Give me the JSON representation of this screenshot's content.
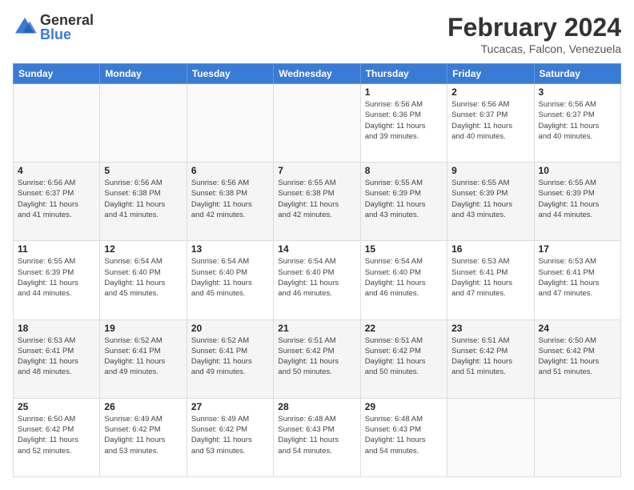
{
  "logo": {
    "general": "General",
    "blue": "Blue"
  },
  "title": "February 2024",
  "subtitle": "Tucacas, Falcon, Venezuela",
  "headers": [
    "Sunday",
    "Monday",
    "Tuesday",
    "Wednesday",
    "Thursday",
    "Friday",
    "Saturday"
  ],
  "weeks": [
    [
      {
        "day": "",
        "info": ""
      },
      {
        "day": "",
        "info": ""
      },
      {
        "day": "",
        "info": ""
      },
      {
        "day": "",
        "info": ""
      },
      {
        "day": "1",
        "info": "Sunrise: 6:56 AM\nSunset: 6:36 PM\nDaylight: 11 hours\nand 39 minutes."
      },
      {
        "day": "2",
        "info": "Sunrise: 6:56 AM\nSunset: 6:37 PM\nDaylight: 11 hours\nand 40 minutes."
      },
      {
        "day": "3",
        "info": "Sunrise: 6:56 AM\nSunset: 6:37 PM\nDaylight: 11 hours\nand 40 minutes."
      }
    ],
    [
      {
        "day": "4",
        "info": "Sunrise: 6:56 AM\nSunset: 6:37 PM\nDaylight: 11 hours\nand 41 minutes."
      },
      {
        "day": "5",
        "info": "Sunrise: 6:56 AM\nSunset: 6:38 PM\nDaylight: 11 hours\nand 41 minutes."
      },
      {
        "day": "6",
        "info": "Sunrise: 6:56 AM\nSunset: 6:38 PM\nDaylight: 11 hours\nand 42 minutes."
      },
      {
        "day": "7",
        "info": "Sunrise: 6:55 AM\nSunset: 6:38 PM\nDaylight: 11 hours\nand 42 minutes."
      },
      {
        "day": "8",
        "info": "Sunrise: 6:55 AM\nSunset: 6:39 PM\nDaylight: 11 hours\nand 43 minutes."
      },
      {
        "day": "9",
        "info": "Sunrise: 6:55 AM\nSunset: 6:39 PM\nDaylight: 11 hours\nand 43 minutes."
      },
      {
        "day": "10",
        "info": "Sunrise: 6:55 AM\nSunset: 6:39 PM\nDaylight: 11 hours\nand 44 minutes."
      }
    ],
    [
      {
        "day": "11",
        "info": "Sunrise: 6:55 AM\nSunset: 6:39 PM\nDaylight: 11 hours\nand 44 minutes."
      },
      {
        "day": "12",
        "info": "Sunrise: 6:54 AM\nSunset: 6:40 PM\nDaylight: 11 hours\nand 45 minutes."
      },
      {
        "day": "13",
        "info": "Sunrise: 6:54 AM\nSunset: 6:40 PM\nDaylight: 11 hours\nand 45 minutes."
      },
      {
        "day": "14",
        "info": "Sunrise: 6:54 AM\nSunset: 6:40 PM\nDaylight: 11 hours\nand 46 minutes."
      },
      {
        "day": "15",
        "info": "Sunrise: 6:54 AM\nSunset: 6:40 PM\nDaylight: 11 hours\nand 46 minutes."
      },
      {
        "day": "16",
        "info": "Sunrise: 6:53 AM\nSunset: 6:41 PM\nDaylight: 11 hours\nand 47 minutes."
      },
      {
        "day": "17",
        "info": "Sunrise: 6:53 AM\nSunset: 6:41 PM\nDaylight: 11 hours\nand 47 minutes."
      }
    ],
    [
      {
        "day": "18",
        "info": "Sunrise: 6:53 AM\nSunset: 6:41 PM\nDaylight: 11 hours\nand 48 minutes."
      },
      {
        "day": "19",
        "info": "Sunrise: 6:52 AM\nSunset: 6:41 PM\nDaylight: 11 hours\nand 49 minutes."
      },
      {
        "day": "20",
        "info": "Sunrise: 6:52 AM\nSunset: 6:41 PM\nDaylight: 11 hours\nand 49 minutes."
      },
      {
        "day": "21",
        "info": "Sunrise: 6:51 AM\nSunset: 6:42 PM\nDaylight: 11 hours\nand 50 minutes."
      },
      {
        "day": "22",
        "info": "Sunrise: 6:51 AM\nSunset: 6:42 PM\nDaylight: 11 hours\nand 50 minutes."
      },
      {
        "day": "23",
        "info": "Sunrise: 6:51 AM\nSunset: 6:42 PM\nDaylight: 11 hours\nand 51 minutes."
      },
      {
        "day": "24",
        "info": "Sunrise: 6:50 AM\nSunset: 6:42 PM\nDaylight: 11 hours\nand 51 minutes."
      }
    ],
    [
      {
        "day": "25",
        "info": "Sunrise: 6:50 AM\nSunset: 6:42 PM\nDaylight: 11 hours\nand 52 minutes."
      },
      {
        "day": "26",
        "info": "Sunrise: 6:49 AM\nSunset: 6:42 PM\nDaylight: 11 hours\nand 53 minutes."
      },
      {
        "day": "27",
        "info": "Sunrise: 6:49 AM\nSunset: 6:42 PM\nDaylight: 11 hours\nand 53 minutes."
      },
      {
        "day": "28",
        "info": "Sunrise: 6:48 AM\nSunset: 6:43 PM\nDaylight: 11 hours\nand 54 minutes."
      },
      {
        "day": "29",
        "info": "Sunrise: 6:48 AM\nSunset: 6:43 PM\nDaylight: 11 hours\nand 54 minutes."
      },
      {
        "day": "",
        "info": ""
      },
      {
        "day": "",
        "info": ""
      }
    ]
  ]
}
